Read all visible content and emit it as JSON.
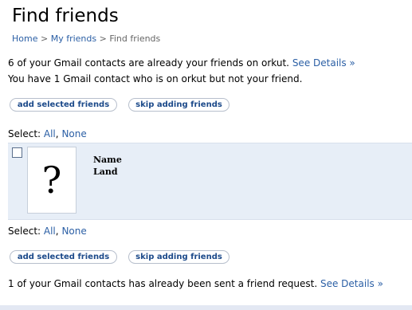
{
  "page": {
    "title": "Find friends"
  },
  "breadcrumb": {
    "home": "Home",
    "separator1": ">",
    "my_friends": "My friends",
    "separator2": ">",
    "current": "Find friends"
  },
  "messages": {
    "already_friends_text": "6 of your Gmail contacts are already your friends on orkut.",
    "already_friends_link": "See Details »",
    "not_friend_text": "You have 1 Gmail contact who is on orkut but not your friend.",
    "request_sent_text": "1 of your Gmail contacts has already been sent a friend request.",
    "request_sent_link": "See Details »"
  },
  "buttons": {
    "add_selected": "add selected friends",
    "skip_adding": "skip adding friends"
  },
  "select": {
    "label": "Select:",
    "all": "All",
    "comma": ",",
    "none": "None"
  },
  "friend": {
    "avatar_placeholder": "?",
    "name": "Name",
    "location": "Land",
    "checked": false
  }
}
